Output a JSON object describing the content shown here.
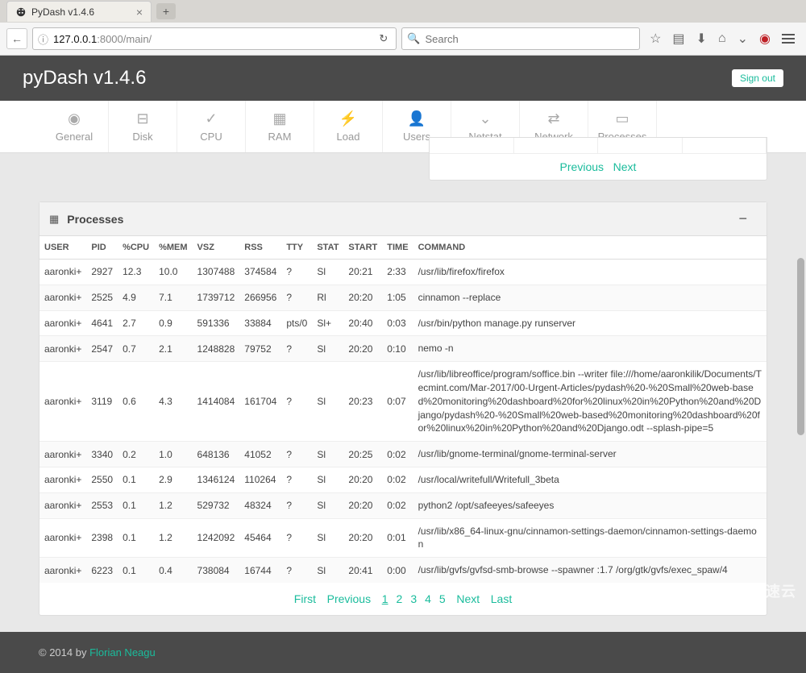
{
  "browser": {
    "tab_title": "PyDash v1.4.6",
    "url_pre": "127.0.0.1",
    "url_port": ":8000/main/",
    "search_placeholder": "Search"
  },
  "header": {
    "title": "pyDash v1.4.6",
    "signout": "Sign out"
  },
  "nav": [
    {
      "label": "General"
    },
    {
      "label": "Disk"
    },
    {
      "label": "CPU"
    },
    {
      "label": "RAM"
    },
    {
      "label": "Load"
    },
    {
      "label": "Users"
    },
    {
      "label": "Netstat"
    },
    {
      "label": "Network"
    },
    {
      "label": "Processes"
    }
  ],
  "top_pager": {
    "prev": "Previous",
    "next": "Next"
  },
  "panel": {
    "title": "Processes",
    "columns": [
      "USER",
      "PID",
      "%CPU",
      "%MEM",
      "VSZ",
      "RSS",
      "TTY",
      "STAT",
      "START",
      "TIME",
      "COMMAND"
    ],
    "rows": [
      {
        "user": "aaronki+",
        "pid": "2927",
        "cpu": "12.3",
        "mem": "10.0",
        "vsz": "1307488",
        "rss": "374584",
        "tty": "?",
        "stat": "Sl",
        "start": "20:21",
        "time": "2:33",
        "cmd": "/usr/lib/firefox/firefox"
      },
      {
        "user": "aaronki+",
        "pid": "2525",
        "cpu": "4.9",
        "mem": "7.1",
        "vsz": "1739712",
        "rss": "266956",
        "tty": "?",
        "stat": "Rl",
        "start": "20:20",
        "time": "1:05",
        "cmd": "cinnamon --replace"
      },
      {
        "user": "aaronki+",
        "pid": "4641",
        "cpu": "2.7",
        "mem": "0.9",
        "vsz": "591336",
        "rss": "33884",
        "tty": "pts/0",
        "stat": "Sl+",
        "start": "20:40",
        "time": "0:03",
        "cmd": "/usr/bin/python manage.py runserver"
      },
      {
        "user": "aaronki+",
        "pid": "2547",
        "cpu": "0.7",
        "mem": "2.1",
        "vsz": "1248828",
        "rss": "79752",
        "tty": "?",
        "stat": "Sl",
        "start": "20:20",
        "time": "0:10",
        "cmd": "nemo -n"
      },
      {
        "user": "aaronki+",
        "pid": "3119",
        "cpu": "0.6",
        "mem": "4.3",
        "vsz": "1414084",
        "rss": "161704",
        "tty": "?",
        "stat": "Sl",
        "start": "20:23",
        "time": "0:07",
        "cmd": "/usr/lib/libreoffice/program/soffice.bin --writer file:///home/aaronkilik/Documents/Tecmint.com/Mar-2017/00-Urgent-Articles/pydash%20-%20Small%20web-based%20monitoring%20dashboard%20for%20linux%20in%20Python%20and%20Django/pydash%20-%20Small%20web-based%20monitoring%20dashboard%20for%20linux%20in%20Python%20and%20Django.odt --splash-pipe=5"
      },
      {
        "user": "aaronki+",
        "pid": "3340",
        "cpu": "0.2",
        "mem": "1.0",
        "vsz": "648136",
        "rss": "41052",
        "tty": "?",
        "stat": "Sl",
        "start": "20:25",
        "time": "0:02",
        "cmd": "/usr/lib/gnome-terminal/gnome-terminal-server"
      },
      {
        "user": "aaronki+",
        "pid": "2550",
        "cpu": "0.1",
        "mem": "2.9",
        "vsz": "1346124",
        "rss": "110264",
        "tty": "?",
        "stat": "Sl",
        "start": "20:20",
        "time": "0:02",
        "cmd": "/usr/local/writefull/Writefull_3beta"
      },
      {
        "user": "aaronki+",
        "pid": "2553",
        "cpu": "0.1",
        "mem": "1.2",
        "vsz": "529732",
        "rss": "48324",
        "tty": "?",
        "stat": "Sl",
        "start": "20:20",
        "time": "0:02",
        "cmd": "python2 /opt/safeeyes/safeeyes"
      },
      {
        "user": "aaronki+",
        "pid": "2398",
        "cpu": "0.1",
        "mem": "1.2",
        "vsz": "1242092",
        "rss": "45464",
        "tty": "?",
        "stat": "Sl",
        "start": "20:20",
        "time": "0:01",
        "cmd": "/usr/lib/x86_64-linux-gnu/cinnamon-settings-daemon/cinnamon-settings-daemon"
      },
      {
        "user": "aaronki+",
        "pid": "6223",
        "cpu": "0.1",
        "mem": "0.4",
        "vsz": "738084",
        "rss": "16744",
        "tty": "?",
        "stat": "Sl",
        "start": "20:41",
        "time": "0:00",
        "cmd": "/usr/lib/gvfs/gvfsd-smb-browse --spawner :1.7 /org/gtk/gvfs/exec_spaw/4"
      }
    ],
    "pager": {
      "first": "First",
      "prev": "Previous",
      "pages": [
        "1",
        "2",
        "3",
        "4",
        "5"
      ],
      "next": "Next",
      "last": "Last",
      "current": "1"
    }
  },
  "footer": {
    "copy": "© 2014 by ",
    "author": "Florian Neagu"
  },
  "watermark": "亿速云"
}
